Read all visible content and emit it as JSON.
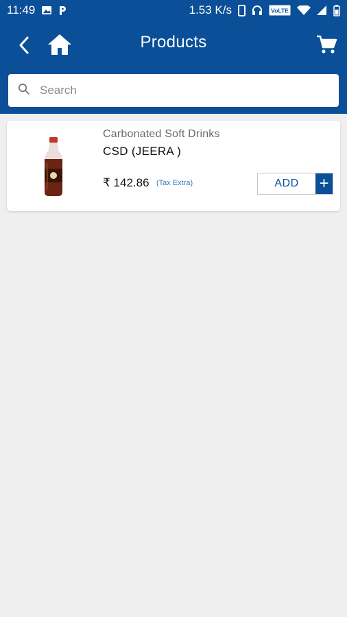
{
  "status_bar": {
    "time": "11:49",
    "network_speed": "1.53 K/s",
    "volte_label": "VoLTE",
    "icons": [
      "image-icon",
      "paytm-p-icon",
      "phone-vibrate-icon",
      "headphones-icon",
      "volte-icon",
      "wifi-icon",
      "signal-icon",
      "battery-icon"
    ]
  },
  "header": {
    "title": "Products",
    "icons": [
      "back-arrow-icon",
      "home-icon",
      "cart-icon"
    ]
  },
  "search": {
    "placeholder": "Search",
    "value": ""
  },
  "products": [
    {
      "category": "Carbonated Soft Drinks",
      "name": "CSD (JEERA )",
      "price": "₹ 142.86",
      "tax_note": "(Tax Extra)",
      "add_label": "ADD",
      "add_plus": "+",
      "image": "cola-bottle-image"
    }
  ],
  "colors": {
    "primary": "#0a4f98",
    "background": "#efefef",
    "card": "#ffffff",
    "tax_text": "#3a7ab8"
  }
}
